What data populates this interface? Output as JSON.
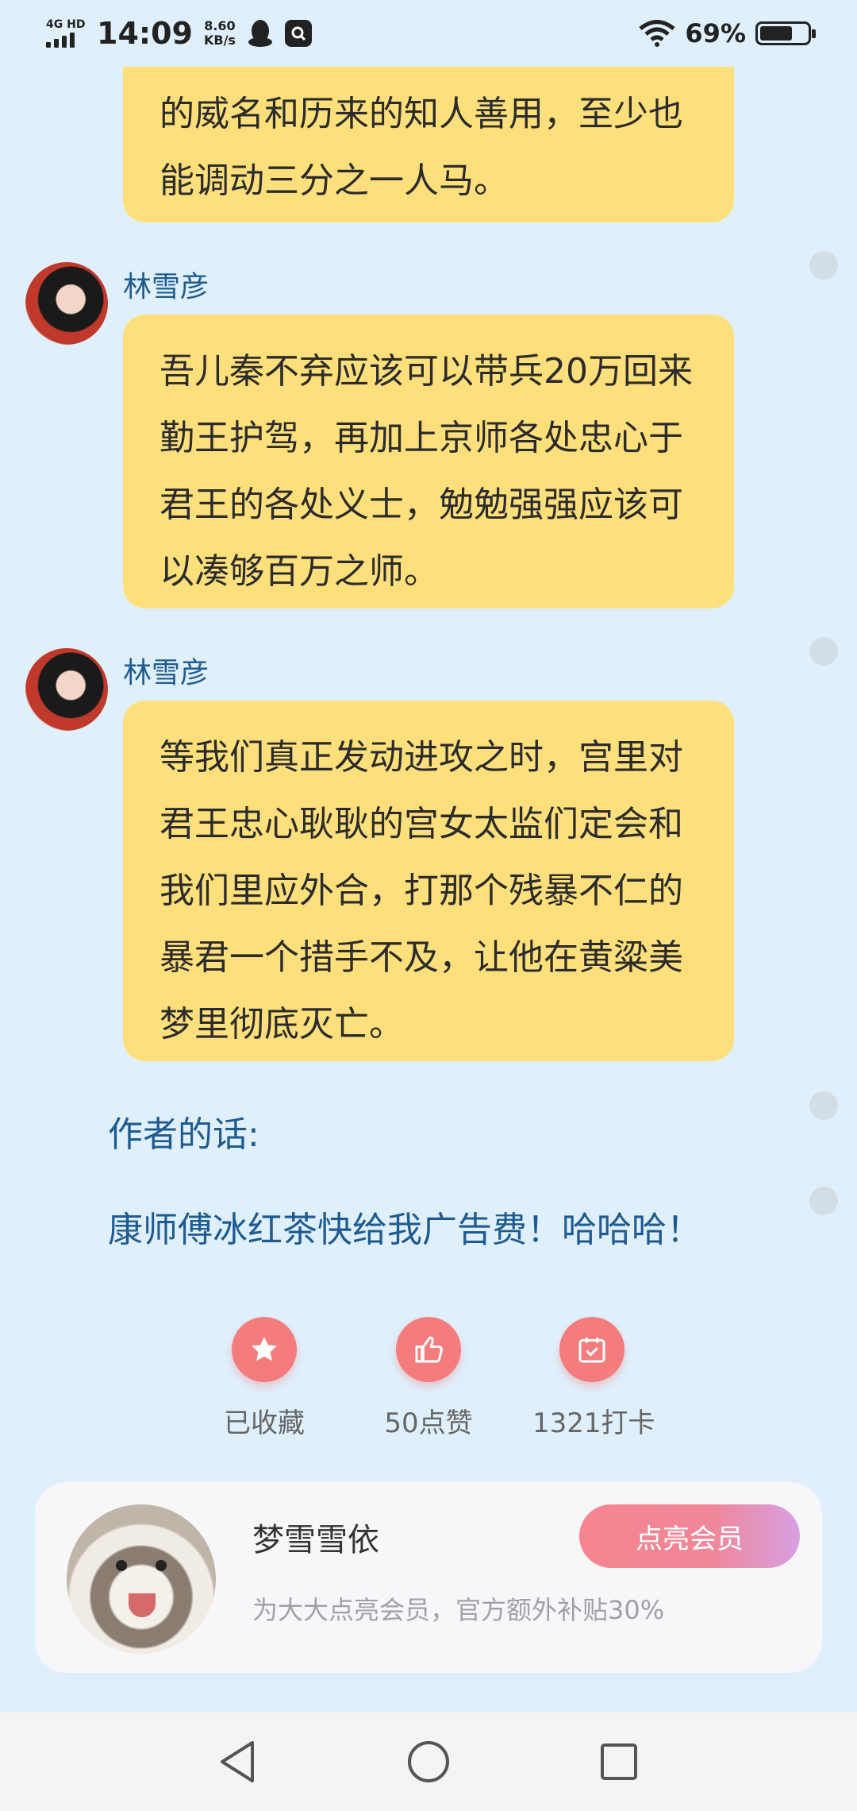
{
  "status_bar": {
    "network": "4G HD",
    "time": "14:09",
    "speed_value": "8.60",
    "speed_unit": "KB/s",
    "battery_text": "69%",
    "battery_level": 0.69,
    "icons": [
      "signal-icon",
      "qq-icon",
      "search-app-icon",
      "wifi-icon",
      "battery-icon"
    ]
  },
  "chat": {
    "messages": [
      {
        "user": "",
        "text": "的威名和历来的知人善用，至少也能调动三分之一人马。"
      },
      {
        "user": "林雪彦",
        "text": "吾儿秦不弃应该可以带兵20万回来勤王护驾，再加上京师各处忠心于君王的各处义士，勉勉强强应该可以凑够百万之师。"
      },
      {
        "user": "林雪彦",
        "text": "等我们真正发动进攻之时，宫里对君王忠心耿耿的宫女太监们定会和我们里应外合，打那个残暴不仁的暴君一个措手不及，让他在黄粱美梦里彻底灭亡。"
      }
    ]
  },
  "author": {
    "title": "作者的话:",
    "text": "康师傅冰红茶快给我广告费！哈哈哈！"
  },
  "actions": [
    {
      "icon": "star-icon",
      "label": "已收藏"
    },
    {
      "icon": "thumbs-up-icon",
      "label": "50点赞"
    },
    {
      "icon": "calendar-check-icon",
      "label": "1321打卡"
    }
  ],
  "member": {
    "name": "梦雪雪依",
    "subtitle": "为大大点亮会员，官方额外补贴30%",
    "button": "点亮会员"
  },
  "nav": {
    "icons": [
      "back-icon",
      "home-icon",
      "recents-icon"
    ]
  },
  "colors": {
    "background": "#dff0fc",
    "bubble": "#fde07c",
    "accent_text": "#1f5b8f",
    "action_circle": "#f47c7c"
  }
}
